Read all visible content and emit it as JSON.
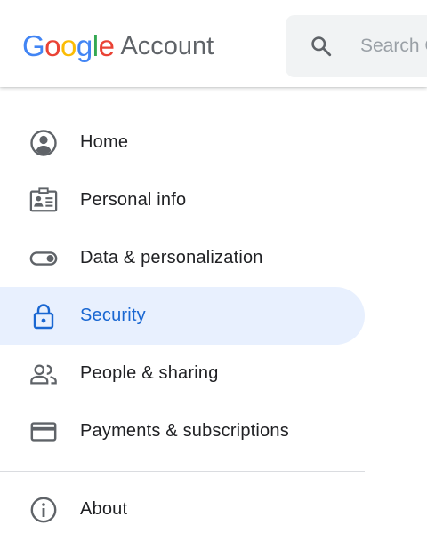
{
  "header": {
    "logo_letters": [
      {
        "char": "G",
        "color": "#4285F4"
      },
      {
        "char": "o",
        "color": "#EA4335"
      },
      {
        "char": "o",
        "color": "#FBBC05"
      },
      {
        "char": "g",
        "color": "#4285F4"
      },
      {
        "char": "l",
        "color": "#34A853"
      },
      {
        "char": "e",
        "color": "#EA4335"
      }
    ],
    "logo_text": "Google",
    "product_name": "Account",
    "search": {
      "placeholder": "Search Google Account",
      "icon": "search-icon"
    }
  },
  "sidebar": {
    "items": [
      {
        "label": "Home",
        "icon": "account-circle-icon",
        "active": false
      },
      {
        "label": "Personal info",
        "icon": "id-card-icon",
        "active": false
      },
      {
        "label": "Data & personalization",
        "icon": "toggle-icon",
        "active": false
      },
      {
        "label": "Security",
        "icon": "lock-icon",
        "active": true
      },
      {
        "label": "People & sharing",
        "icon": "people-icon",
        "active": false
      },
      {
        "label": "Payments & subscriptions",
        "icon": "credit-card-icon",
        "active": false
      }
    ],
    "footer_items": [
      {
        "label": "About",
        "icon": "info-icon",
        "active": false
      }
    ]
  },
  "colors": {
    "active_bg": "#e8f0fe",
    "active_text": "#1967d2",
    "icon_gray": "#5f6368",
    "text_dark": "#202124"
  }
}
